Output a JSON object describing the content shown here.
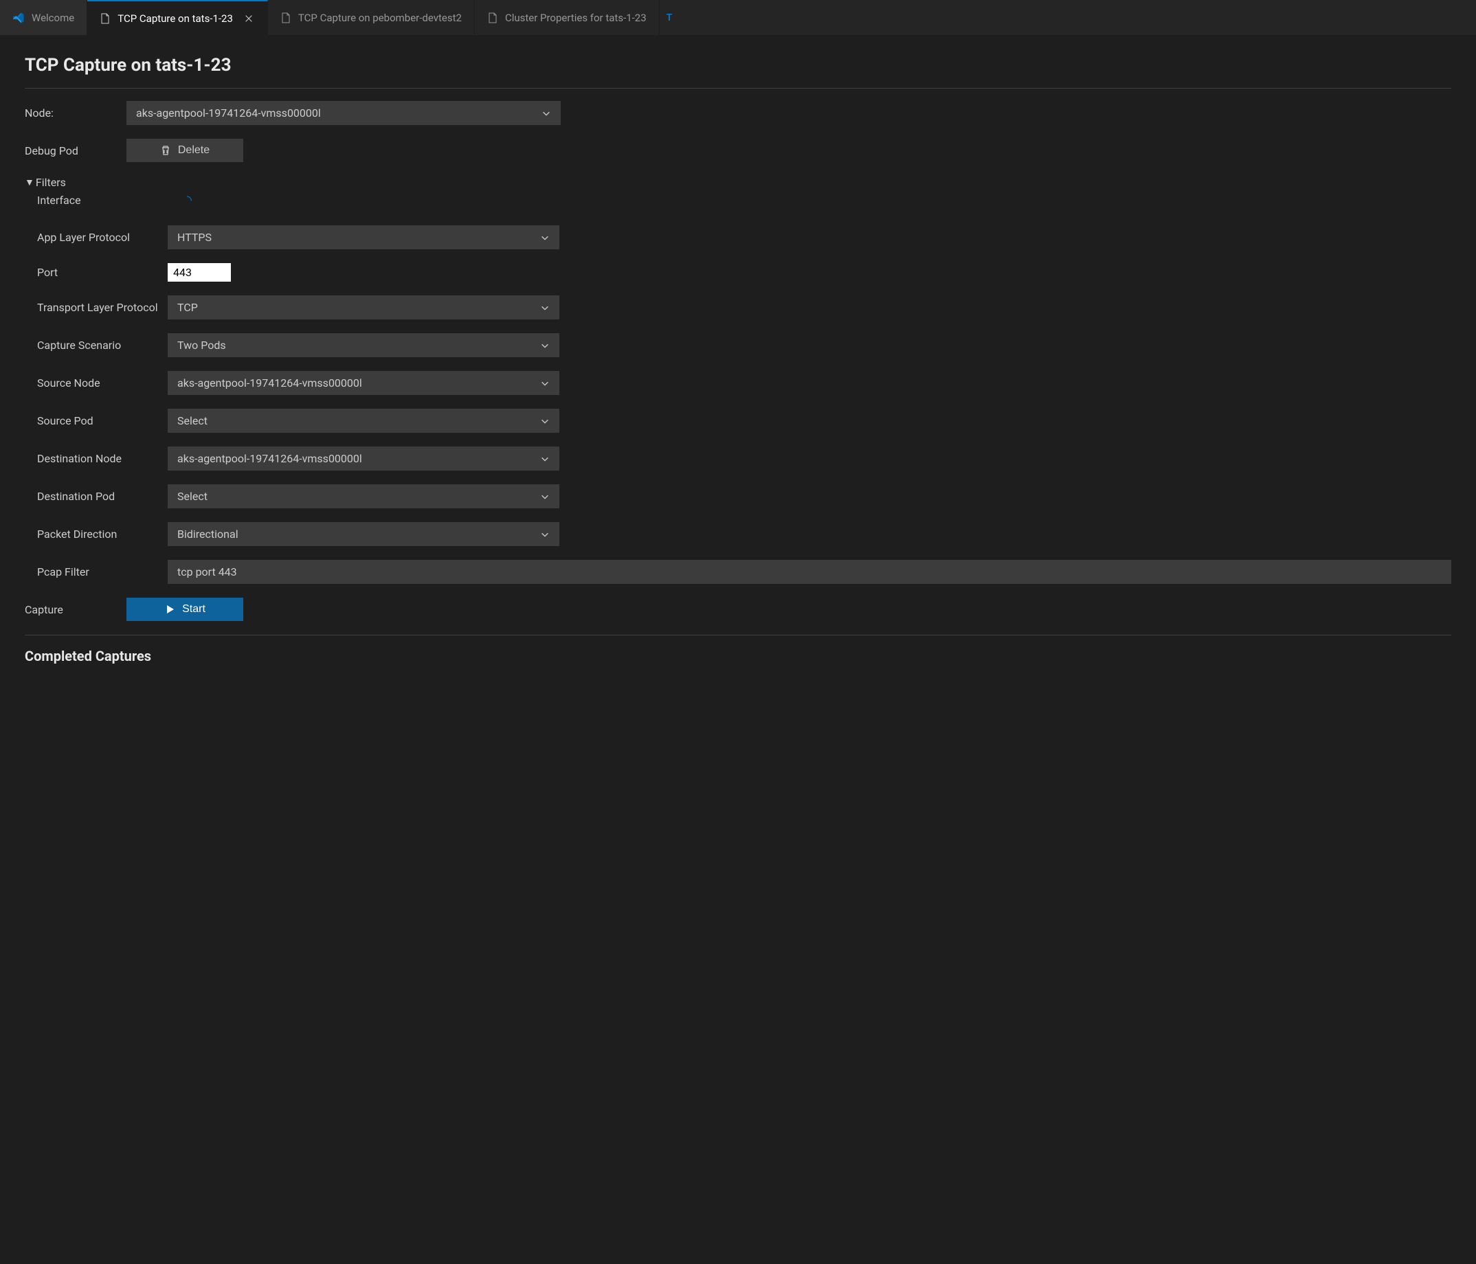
{
  "tabs": {
    "welcome": "Welcome",
    "tab1": "TCP Capture on tats-1-23",
    "tab2": "TCP Capture on pebomber-devtest2",
    "tab3": "Cluster Properties for tats-1-23",
    "overflow": "T"
  },
  "page": {
    "title": "TCP Capture on tats-1-23"
  },
  "form": {
    "node_label": "Node:",
    "node_value": "aks-agentpool-19741264-vmss00000l",
    "debug_pod_label": "Debug Pod",
    "delete_label": "Delete",
    "filters_label": "Filters",
    "interface_label": "Interface",
    "app_protocol_label": "App Layer Protocol",
    "app_protocol_value": "HTTPS",
    "port_label": "Port",
    "port_value": "443",
    "transport_label": "Transport Layer Protocol",
    "transport_value": "TCP",
    "scenario_label": "Capture Scenario",
    "scenario_value": "Two Pods",
    "source_node_label": "Source Node",
    "source_node_value": "aks-agentpool-19741264-vmss00000l",
    "source_pod_label": "Source Pod",
    "source_pod_value": "Select",
    "dest_node_label": "Destination Node",
    "dest_node_value": "aks-agentpool-19741264-vmss00000l",
    "dest_pod_label": "Destination Pod",
    "dest_pod_value": "Select",
    "direction_label": "Packet Direction",
    "direction_value": "Bidirectional",
    "pcap_label": "Pcap Filter",
    "pcap_value": "tcp port 443",
    "capture_label": "Capture",
    "start_label": "Start"
  },
  "sections": {
    "completed_captures": "Completed Captures"
  }
}
